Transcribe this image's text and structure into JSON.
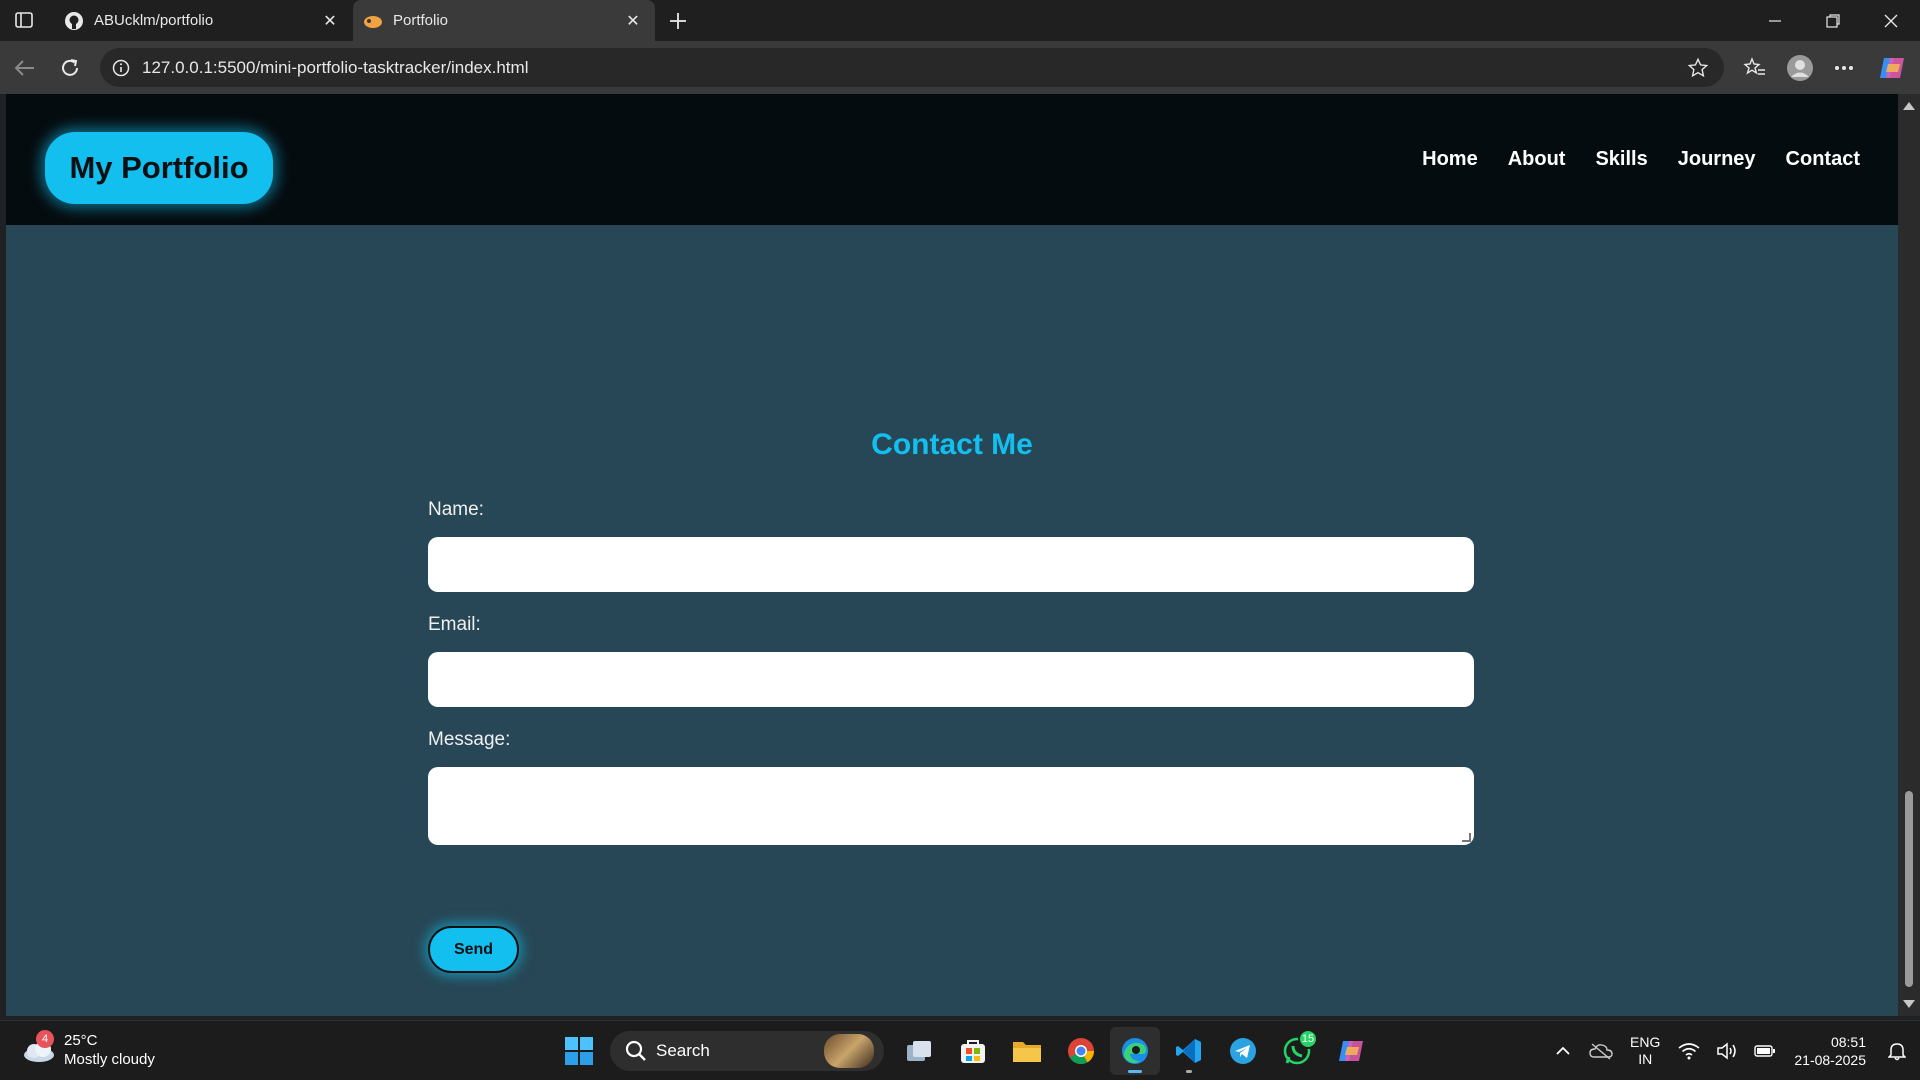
{
  "browser": {
    "tabs": [
      {
        "title": "ABUcklm/portfolio",
        "icon": "github-icon",
        "active": false
      },
      {
        "title": "Portfolio",
        "icon": "portfolio-favicon",
        "active": true
      }
    ],
    "address": "127.0.0.1:5500/mini-portfolio-tasktracker/index.html"
  },
  "site": {
    "logo": "My Portfolio",
    "nav": [
      "Home",
      "About",
      "Skills",
      "Journey",
      "Contact"
    ],
    "accent_color": "#12bfee",
    "background_color": "#274756",
    "header_color": "#050c0f"
  },
  "contact": {
    "title": "Contact Me",
    "fields": [
      {
        "label": "Name:",
        "value": ""
      },
      {
        "label": "Email:",
        "value": ""
      },
      {
        "label": "Message:",
        "value": ""
      }
    ],
    "submit": "Send"
  },
  "taskbar": {
    "weather": {
      "temp": "25°C",
      "condition": "Mostly cloudy",
      "badge": "4"
    },
    "search": "Search",
    "whatsapp_badge": "15",
    "lang_line1": "ENG",
    "lang_line2": "IN",
    "time": "08:51",
    "date": "21-08-2025"
  }
}
